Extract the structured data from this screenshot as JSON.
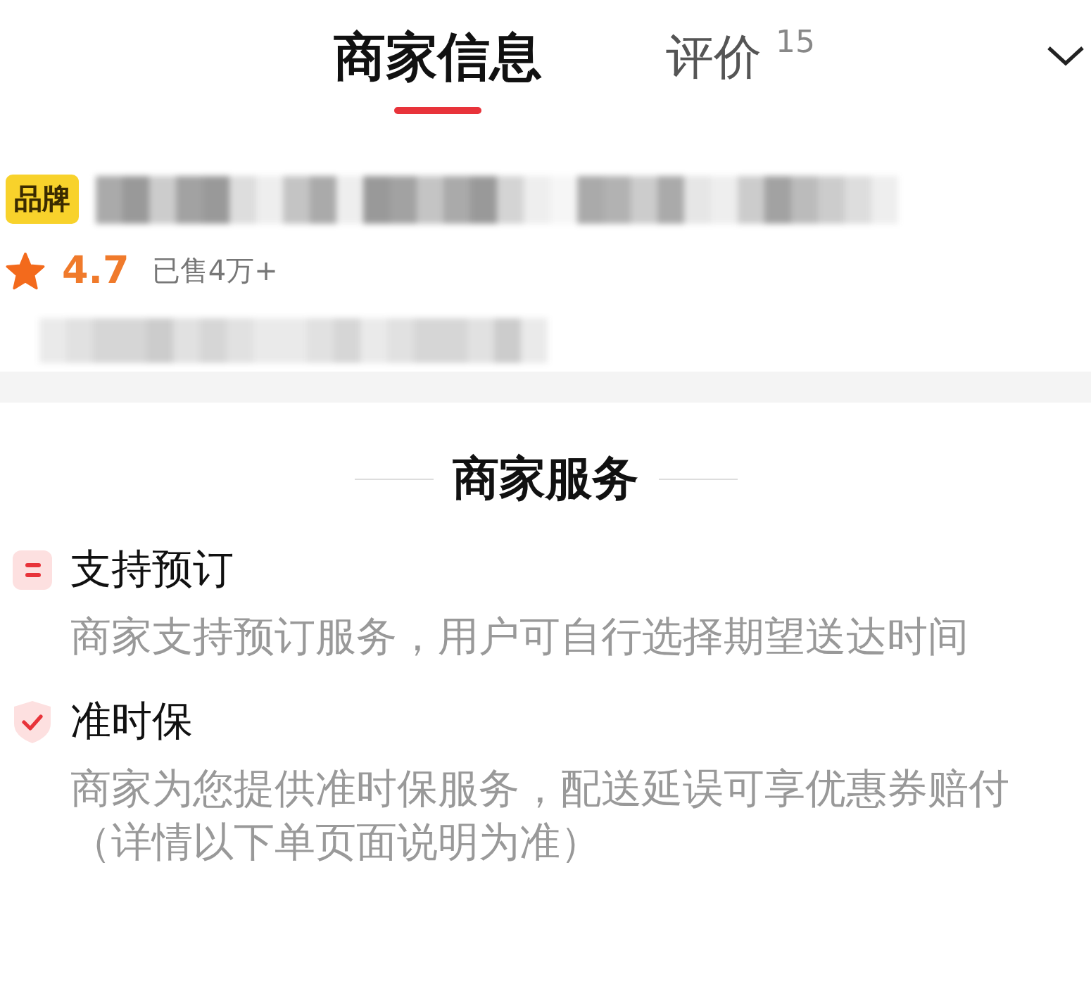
{
  "tabs": [
    {
      "label": "商家信息",
      "selected": true
    },
    {
      "label": "评价",
      "count": "15",
      "selected": false
    }
  ],
  "store": {
    "badge": "品牌",
    "rating": "4.7",
    "sold": "已售4万+"
  },
  "services_title": "商家服务",
  "services": [
    {
      "kind": "booking",
      "title": "支持预订",
      "description": "商家支持预订服务，用户可自行选择期望送达时间"
    },
    {
      "kind": "shield",
      "title": "准时保",
      "description": "商家为您提供准时保服务，配送延误可享优惠券赔付（详情以下单页面说明为准）"
    }
  ]
}
